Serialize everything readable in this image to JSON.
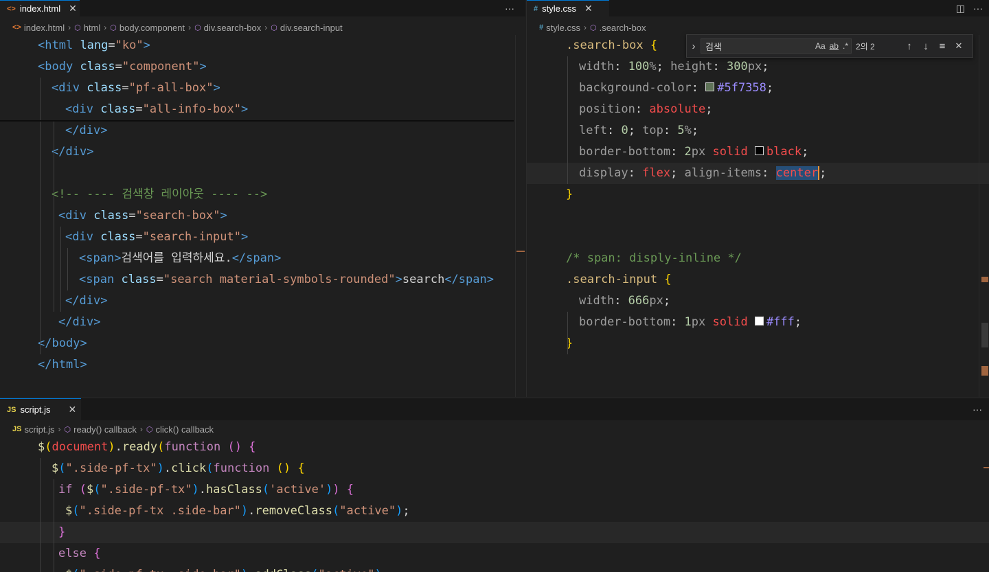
{
  "html_pane": {
    "tab_label": "index.html",
    "tab_icon": "<>",
    "close_glyph": "✕",
    "more_glyph": "···",
    "breadcrumb": [
      "index.html",
      "html",
      "body.component",
      "div.search-box",
      "div.search-input"
    ],
    "lines": [
      {
        "indent": 0,
        "parts": [
          [
            "<",
            "c-tag"
          ],
          [
            "html ",
            "c-tag"
          ],
          [
            "lang",
            "c-attr"
          ],
          [
            "=",
            "c-txt"
          ],
          [
            "\"ko\"",
            "c-str"
          ],
          [
            ">",
            "c-tag"
          ]
        ]
      },
      {
        "indent": 0,
        "parts": [
          [
            "<",
            "c-tag"
          ],
          [
            "body ",
            "c-tag"
          ],
          [
            "class",
            "c-attr"
          ],
          [
            "=",
            "c-txt"
          ],
          [
            "\"component\"",
            "c-str"
          ],
          [
            ">",
            "c-tag"
          ]
        ]
      },
      {
        "indent": 1,
        "parts": [
          [
            "<",
            "c-tag"
          ],
          [
            "div ",
            "c-tag"
          ],
          [
            "class",
            "c-attr"
          ],
          [
            "=",
            "c-txt"
          ],
          [
            "\"pf-all-box\"",
            "c-str"
          ],
          [
            ">",
            "c-tag"
          ]
        ]
      },
      {
        "indent": 2,
        "parts": [
          [
            "<",
            "c-tag"
          ],
          [
            "div ",
            "c-tag"
          ],
          [
            "class",
            "c-attr"
          ],
          [
            "=",
            "c-txt"
          ],
          [
            "\"all-info-box\"",
            "c-str"
          ],
          [
            ">",
            "c-tag"
          ]
        ]
      },
      {
        "indent": 2,
        "parts": [
          [
            "</",
            "c-tag"
          ],
          [
            "div",
            "c-tag"
          ],
          [
            ">",
            "c-tag"
          ]
        ]
      },
      {
        "indent": 1,
        "parts": [
          [
            "</",
            "c-tag"
          ],
          [
            "div",
            "c-tag"
          ],
          [
            ">",
            "c-tag"
          ]
        ]
      },
      {
        "indent": 0,
        "parts": []
      },
      {
        "indent": 1,
        "parts": [
          [
            "<!-- ---- 검색창 레이아웃 ---- -->",
            "c-cmt"
          ]
        ]
      },
      {
        "indent": 1.5,
        "parts": [
          [
            "<",
            "c-tag"
          ],
          [
            "div ",
            "c-tag"
          ],
          [
            "class",
            "c-attr"
          ],
          [
            "=",
            "c-txt"
          ],
          [
            "\"search-box\"",
            "c-str"
          ],
          [
            ">",
            "c-tag"
          ]
        ]
      },
      {
        "indent": 2,
        "parts": [
          [
            "<",
            "c-tag"
          ],
          [
            "div ",
            "c-tag"
          ],
          [
            "class",
            "c-attr"
          ],
          [
            "=",
            "c-txt"
          ],
          [
            "\"search-input\"",
            "c-str"
          ],
          [
            ">",
            "c-tag"
          ]
        ]
      },
      {
        "indent": 3,
        "parts": [
          [
            "<",
            "c-tag"
          ],
          [
            "span",
            "c-tag"
          ],
          [
            ">",
            "c-tag"
          ],
          [
            "검색어를 입력하세요.",
            "c-txt"
          ],
          [
            "</",
            "c-tag"
          ],
          [
            "span",
            "c-tag"
          ],
          [
            ">",
            "c-tag"
          ]
        ]
      },
      {
        "indent": 3,
        "parts": [
          [
            "<",
            "c-tag"
          ],
          [
            "span ",
            "c-tag"
          ],
          [
            "class",
            "c-attr"
          ],
          [
            "=",
            "c-txt"
          ],
          [
            "\"search material-symbols-rounded\"",
            "c-str"
          ],
          [
            ">",
            "c-tag"
          ],
          [
            "search",
            "c-txt"
          ],
          [
            "</",
            "c-tag"
          ],
          [
            "span",
            "c-tag"
          ],
          [
            ">",
            "c-tag"
          ]
        ]
      },
      {
        "indent": 2,
        "parts": [
          [
            "</",
            "c-tag"
          ],
          [
            "div",
            "c-tag"
          ],
          [
            ">",
            "c-tag"
          ]
        ]
      },
      {
        "indent": 1.5,
        "parts": [
          [
            "</",
            "c-tag"
          ],
          [
            "div",
            "c-tag"
          ],
          [
            ">",
            "c-tag"
          ]
        ]
      },
      {
        "indent": 0,
        "parts": [
          [
            "</",
            "c-tag"
          ],
          [
            "body",
            "c-tag"
          ],
          [
            ">",
            "c-tag"
          ]
        ]
      },
      {
        "indent": 0,
        "parts": [
          [
            "</",
            "c-tag"
          ],
          [
            "html",
            "c-tag"
          ],
          [
            ">",
            "c-tag"
          ]
        ]
      }
    ]
  },
  "css_pane": {
    "tab_label": "style.css",
    "tab_icon": "#",
    "close_glyph": "✕",
    "split_glyph": "◫",
    "more_glyph": "···",
    "breadcrumb": [
      "style.css",
      ".search-box"
    ],
    "find": {
      "toggle_glyph": "›",
      "query": "검색",
      "match_case": "Aa",
      "whole_word": "ab",
      "regex": ".*",
      "count": "2의 2",
      "prev_glyph": "↑",
      "next_glyph": "↓",
      "selection_glyph": "≡",
      "close_glyph": "✕"
    },
    "lines": [
      {
        "indent": 0,
        "parts": [
          [
            ".search-box ",
            "css-sel"
          ],
          [
            "{",
            "brace"
          ]
        ]
      },
      {
        "indent": 1,
        "parts": [
          [
            "width",
            "css-prop"
          ],
          [
            ": ",
            "c-txt"
          ],
          [
            "100",
            "css-num"
          ],
          [
            "%",
            "css-prop"
          ],
          [
            "; ",
            "c-txt"
          ],
          [
            "height",
            "css-prop"
          ],
          [
            ": ",
            "c-txt"
          ],
          [
            "300",
            "css-num"
          ],
          [
            "px",
            "css-prop"
          ],
          [
            ";",
            "c-txt"
          ]
        ]
      },
      {
        "indent": 1,
        "parts": [
          [
            "background-color",
            "css-prop"
          ],
          [
            ": ",
            "c-txt"
          ],
          [
            "#swatch#5f7358",
            "swatch"
          ],
          [
            "#5f7358",
            "css-hex"
          ],
          [
            ";",
            "c-txt"
          ]
        ]
      },
      {
        "indent": 1,
        "parts": [
          [
            "position",
            "css-prop"
          ],
          [
            ": ",
            "c-txt"
          ],
          [
            "absolute",
            "css-kw"
          ],
          [
            ";",
            "c-txt"
          ]
        ]
      },
      {
        "indent": 1,
        "parts": [
          [
            "left",
            "css-prop"
          ],
          [
            ": ",
            "c-txt"
          ],
          [
            "0",
            "css-num"
          ],
          [
            "; ",
            "c-txt"
          ],
          [
            "top",
            "css-prop"
          ],
          [
            ": ",
            "c-txt"
          ],
          [
            "5",
            "css-num"
          ],
          [
            "%",
            "css-prop"
          ],
          [
            ";",
            "c-txt"
          ]
        ]
      },
      {
        "indent": 1,
        "parts": [
          [
            "border-bottom",
            "css-prop"
          ],
          [
            ": ",
            "c-txt"
          ],
          [
            "2",
            "css-num"
          ],
          [
            "px ",
            "css-prop"
          ],
          [
            "solid ",
            "css-kw"
          ],
          [
            "#swatch#000000",
            "swatch"
          ],
          [
            "black",
            "css-kw"
          ],
          [
            ";",
            "c-txt"
          ]
        ]
      },
      {
        "indent": 1,
        "parts": [
          [
            "display",
            "css-prop"
          ],
          [
            ": ",
            "c-txt"
          ],
          [
            "flex",
            "css-kw"
          ],
          [
            "; ",
            "c-txt"
          ],
          [
            "align-items",
            "css-prop"
          ],
          [
            ": ",
            "c-txt"
          ],
          [
            "center",
            "css-kw-sel"
          ],
          [
            ";",
            "c-txt"
          ]
        ]
      },
      {
        "indent": 0,
        "parts": [
          [
            "}",
            "brace"
          ]
        ]
      },
      {
        "indent": 0,
        "parts": []
      },
      {
        "indent": 0,
        "parts": []
      },
      {
        "indent": 0,
        "parts": [
          [
            "/* span: disply-inline */",
            "c-cmt"
          ]
        ]
      },
      {
        "indent": 0,
        "parts": [
          [
            ".search-input ",
            "css-sel"
          ],
          [
            "{",
            "brace"
          ]
        ]
      },
      {
        "indent": 1,
        "parts": [
          [
            "width",
            "css-prop"
          ],
          [
            ": ",
            "c-txt"
          ],
          [
            "666",
            "css-num"
          ],
          [
            "px",
            "css-prop"
          ],
          [
            ";",
            "c-txt"
          ]
        ]
      },
      {
        "indent": 1,
        "parts": [
          [
            "border-bottom",
            "css-prop"
          ],
          [
            ": ",
            "c-txt"
          ],
          [
            "1",
            "css-num"
          ],
          [
            "px ",
            "css-prop"
          ],
          [
            "solid ",
            "css-kw"
          ],
          [
            "#swatch#ffffff",
            "swatch"
          ],
          [
            "#fff",
            "css-hex"
          ],
          [
            ";",
            "c-txt"
          ]
        ]
      },
      {
        "indent": 0,
        "parts": [
          [
            "}",
            "brace"
          ]
        ]
      }
    ]
  },
  "js_pane": {
    "tab_label": "script.js",
    "tab_icon": "JS",
    "close_glyph": "✕",
    "more_glyph": "···",
    "breadcrumb": [
      "script.js",
      "ready() callback",
      "click() callback"
    ],
    "lines": [
      {
        "indent": 0,
        "parts": [
          [
            "$",
            "js-fn"
          ],
          [
            "(",
            "js-par1"
          ],
          [
            "document",
            "css-kw"
          ],
          [
            ")",
            "js-par1"
          ],
          [
            ".",
            "c-txt"
          ],
          [
            "ready",
            "js-fn"
          ],
          [
            "(",
            "js-par1"
          ],
          [
            "function ",
            "js-kw"
          ],
          [
            "() ",
            "js-par2"
          ],
          [
            "{",
            "js-par2"
          ]
        ]
      },
      {
        "indent": 1,
        "parts": [
          [
            "$",
            "js-fn"
          ],
          [
            "(",
            "js-par3"
          ],
          [
            "\".side-pf-tx\"",
            "js-str"
          ],
          [
            ")",
            "js-par3"
          ],
          [
            ".",
            "c-txt"
          ],
          [
            "click",
            "js-fn"
          ],
          [
            "(",
            "js-par3"
          ],
          [
            "function ",
            "js-kw"
          ],
          [
            "() ",
            "js-par1"
          ],
          [
            "{",
            "js-par1"
          ]
        ]
      },
      {
        "indent": 1.5,
        "parts": [
          [
            "if ",
            "js-kw"
          ],
          [
            "(",
            "js-par2"
          ],
          [
            "$",
            "js-fn"
          ],
          [
            "(",
            "js-par3"
          ],
          [
            "\".side-pf-tx\"",
            "js-str"
          ],
          [
            ")",
            "js-par3"
          ],
          [
            ".",
            "c-txt"
          ],
          [
            "hasClass",
            "js-fn"
          ],
          [
            "(",
            "js-par3"
          ],
          [
            "'active'",
            "js-str"
          ],
          [
            ")",
            "js-par3"
          ],
          [
            ")",
            "js-par2"
          ],
          [
            " {",
            "js-par2"
          ]
        ]
      },
      {
        "indent": 2,
        "parts": [
          [
            "$",
            "js-fn"
          ],
          [
            "(",
            "js-par3"
          ],
          [
            "\".side-pf-tx .side-bar\"",
            "js-str"
          ],
          [
            ")",
            "js-par3"
          ],
          [
            ".",
            "c-txt"
          ],
          [
            "removeClass",
            "js-fn"
          ],
          [
            "(",
            "js-par3"
          ],
          [
            "\"active\"",
            "js-str"
          ],
          [
            ")",
            "js-par3"
          ],
          [
            ";",
            "c-txt"
          ]
        ]
      },
      {
        "indent": 1.5,
        "parts": [
          [
            "}",
            "js-par2"
          ]
        ]
      },
      {
        "indent": 1.5,
        "parts": [
          [
            "else ",
            "js-kw"
          ],
          [
            "{",
            "js-par2"
          ]
        ]
      },
      {
        "indent": 2,
        "parts": [
          [
            "$",
            "js-fn"
          ],
          [
            "(",
            "js-par3"
          ],
          [
            "\".side-pf-tx .side-bar\"",
            "js-str"
          ],
          [
            ")",
            "js-par3"
          ],
          [
            ".",
            "c-txt"
          ],
          [
            "addClass",
            "js-fn"
          ],
          [
            "(",
            "js-par3"
          ],
          [
            "\"active\"",
            "js-str"
          ],
          [
            ")",
            "js-par3"
          ],
          [
            ";",
            "c-txt"
          ]
        ]
      }
    ]
  },
  "colors": {
    "editor_bg": "#1f1f1f",
    "tabbar_bg": "#181818",
    "accent": "#0078d4",
    "find_bg": "#252526"
  }
}
